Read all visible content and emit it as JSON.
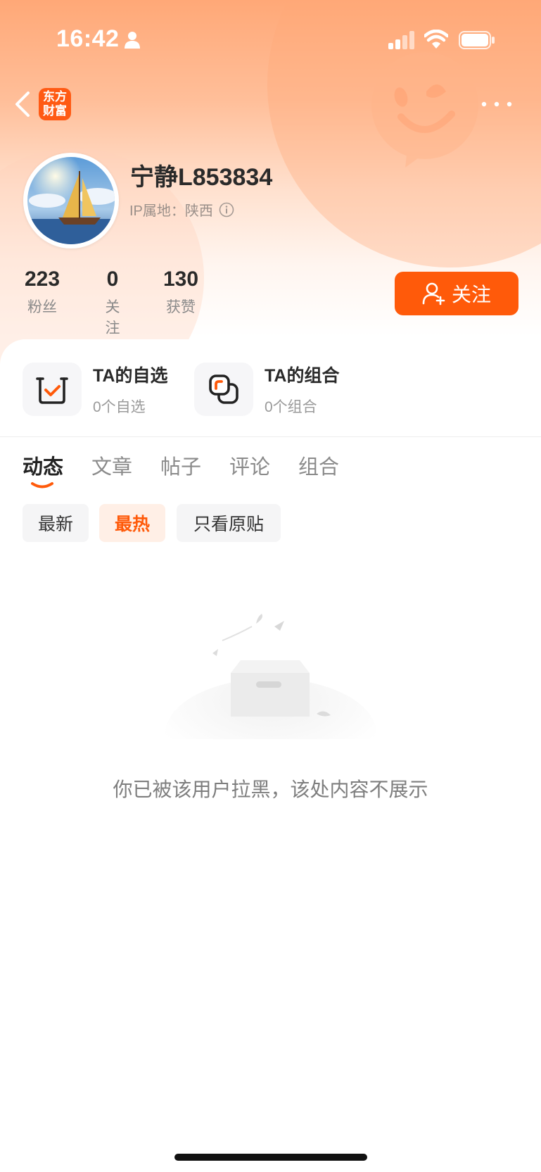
{
  "status_bar": {
    "time": "16:42",
    "icons": [
      "person-icon",
      "signal-icon",
      "wifi-icon",
      "battery-icon"
    ]
  },
  "header": {
    "back_icon": "chevron-left-icon",
    "app_logo_line1": "东方",
    "app_logo_line2": "财富",
    "more_icon": "more-dots-icon"
  },
  "profile": {
    "username": "宁静L853834",
    "ip_location": "IP属地：陕西",
    "info_icon": "info-icon",
    "stats": [
      {
        "value": "223",
        "label": "粉丝"
      },
      {
        "value": "0",
        "label": "关注"
      },
      {
        "value": "130",
        "label": "获赞"
      }
    ],
    "follow_button": "关注"
  },
  "quick_links": [
    {
      "title": "TA的自选",
      "subtitle": "0个自选",
      "icon": "watchlist-check-icon"
    },
    {
      "title": "TA的组合",
      "subtitle": "0个组合",
      "icon": "portfolio-combo-icon"
    }
  ],
  "tabs": [
    "动态",
    "文章",
    "帖子",
    "评论",
    "组合"
  ],
  "active_tab": "动态",
  "filters": [
    "最新",
    "最热",
    "只看原贴"
  ],
  "active_filter": "最热",
  "empty_state": {
    "icon": "empty-box-illustration",
    "message": "你已被该用户拉黑，该处内容不展示"
  },
  "colors": {
    "accent": "#ff5a0a",
    "hero_top": "#ffa877",
    "text_primary": "#2a2a2a",
    "text_secondary": "#8a8a8a"
  }
}
